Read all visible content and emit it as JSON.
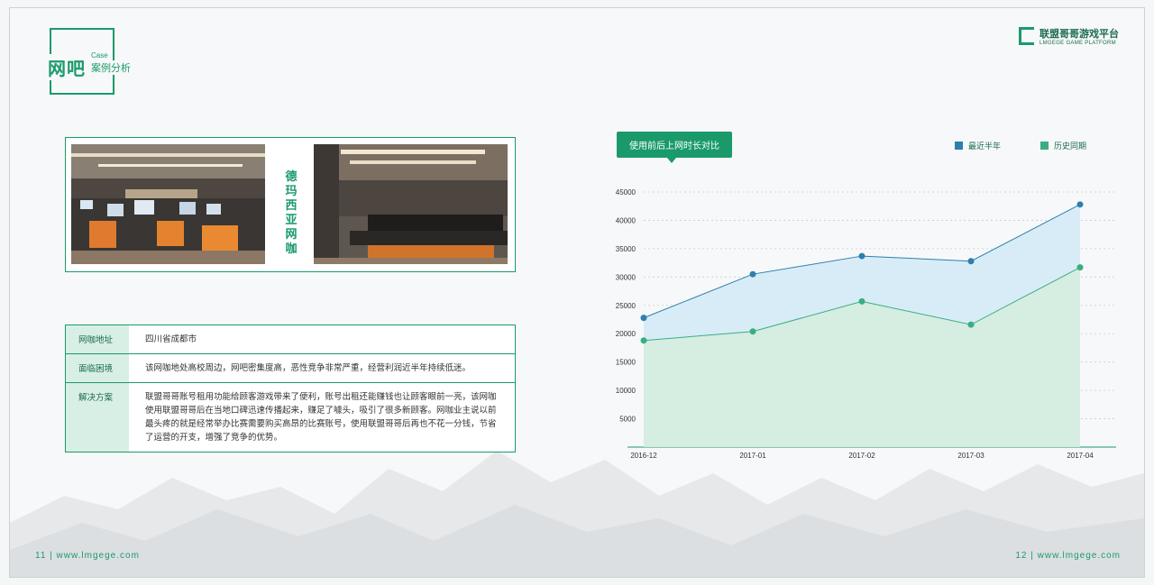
{
  "header": {
    "title_big": "网吧",
    "title_case": "Case",
    "title_sub": "案例分析",
    "brand_name": "联盟哥哥游戏平台",
    "brand_en": "LMGEGE GAME PLATFORM"
  },
  "cafe": {
    "name": "德玛西亚网咖"
  },
  "info": [
    {
      "label": "网咖地址",
      "value": "四川省成都市"
    },
    {
      "label": "面临困境",
      "value": "该网咖地处高校周边，网吧密集度高，恶性竞争非常严重，经营利润近半年持续低迷。"
    },
    {
      "label": "解决方案",
      "value": "联盟哥哥账号租用功能给顾客游戏带来了便利，账号出租还能赚钱也让顾客眼前一亮，该网咖使用联盟哥哥后在当地口碑迅速传播起来，赚足了噱头，吸引了很多新顾客。网咖业主说以前最头疼的就是经常举办比赛需要购买高昂的比赛账号，使用联盟哥哥后再也不花一分钱，节省了运营的开支，增强了竞争的优势。"
    }
  ],
  "chart_tag": "使用前后上网时长对比",
  "chart_data": {
    "type": "area",
    "categories": [
      "2016-12",
      "2017-01",
      "2017-02",
      "2017-03",
      "2017-04"
    ],
    "series": [
      {
        "name": "最近半年",
        "values": [
          22800,
          30500,
          33700,
          32800,
          42800
        ],
        "color": "#2e7fb0"
      },
      {
        "name": "历史同期",
        "values": [
          18800,
          20400,
          25700,
          21600,
          31700
        ],
        "color": "#3aae82"
      }
    ],
    "yticks": [
      5000,
      10000,
      15000,
      20000,
      25000,
      30000,
      35000,
      40000,
      45000
    ],
    "ylim": [
      0,
      45000
    ],
    "grid": true,
    "legend": "top-right"
  },
  "footer": {
    "left": "11 | www.lmgege.com",
    "right": "12 | www.lmgege.com"
  }
}
